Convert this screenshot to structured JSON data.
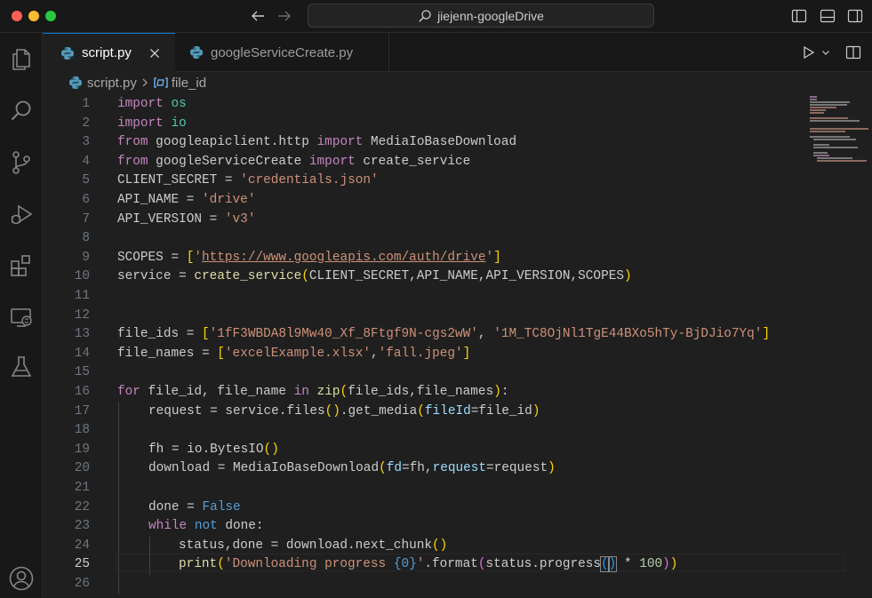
{
  "window": {
    "title": "jiejenn-googleDrive"
  },
  "tabs": [
    {
      "label": "script.py",
      "active": true
    },
    {
      "label": "googleServiceCreate.py",
      "active": false
    }
  ],
  "breadcrumb": {
    "file": "script.py",
    "symbol": "file_id"
  },
  "editor": {
    "current_line": 25,
    "lines": [
      {
        "n": "1"
      },
      {
        "n": "2"
      },
      {
        "n": "3"
      },
      {
        "n": "4"
      },
      {
        "n": "5"
      },
      {
        "n": "6"
      },
      {
        "n": "7"
      },
      {
        "n": "8"
      },
      {
        "n": "9"
      },
      {
        "n": "10"
      },
      {
        "n": "11"
      },
      {
        "n": "12"
      },
      {
        "n": "13"
      },
      {
        "n": "14"
      },
      {
        "n": "15"
      },
      {
        "n": "16"
      },
      {
        "n": "17"
      },
      {
        "n": "18"
      },
      {
        "n": "19"
      },
      {
        "n": "20"
      },
      {
        "n": "21"
      },
      {
        "n": "22"
      },
      {
        "n": "23"
      },
      {
        "n": "24"
      },
      {
        "n": "25"
      },
      {
        "n": "26"
      }
    ],
    "tokens": {
      "l1": [
        "import",
        " os"
      ],
      "l2": [
        "import",
        " io"
      ],
      "l3": [
        "from",
        " googleapiclient.http ",
        "import",
        " MediaIoBaseDownload"
      ],
      "l4": [
        "from",
        " googleServiceCreate ",
        "import",
        " create_service"
      ],
      "l5": [
        "CLIENT_SECRET = ",
        "'credentials.json'"
      ],
      "l6": [
        "API_NAME = ",
        "'drive'"
      ],
      "l7": [
        "API_VERSION = ",
        "'v3'"
      ],
      "l9": [
        "SCOPES = ",
        "[",
        "'",
        "https://www.googleapis.com/auth/drive",
        "'",
        "]"
      ],
      "l10": [
        "service = ",
        "create_service",
        "(",
        "CLIENT_SECRET,API_NAME,API_VERSION,SCOPES",
        ")"
      ],
      "l13": [
        "file_ids = ",
        "[",
        "'1fF3WBDA8l9Mw40_Xf_8Ftgf9N-cgs2wW'",
        ", ",
        "'1M_TC8OjNl1TgE44BXo5hTy-BjDJio7Yq'",
        "]"
      ],
      "l14": [
        "file_names = ",
        "[",
        "'excelExample.xlsx'",
        ",",
        "'fall.jpeg'",
        "]"
      ],
      "l16": [
        "for",
        " file_id, file_name ",
        "in",
        " ",
        "zip",
        "(",
        "file_ids,file_names",
        ")",
        ":"
      ],
      "l17": [
        "request = service.files",
        "(",
        ")",
        ".get_media",
        "(",
        "fileId",
        "=file_id",
        ")"
      ],
      "l19": [
        "fh = io.",
        "BytesIO",
        "(",
        ")"
      ],
      "l20": [
        "download = ",
        "MediaIoBaseDownload",
        "(",
        "fd",
        "=fh,",
        "request",
        "=request",
        ")"
      ],
      "l22": [
        "done = ",
        "False"
      ],
      "l23": [
        "while",
        " ",
        "not",
        " done:"
      ],
      "l24": [
        "status,done = download.next_chunk",
        "(",
        ")"
      ],
      "l25": [
        "print",
        "(",
        "'Downloading progress ",
        "{0}",
        "'",
        ".format",
        "(",
        "status.progress",
        "(",
        ")",
        " * ",
        "100",
        ")",
        ")"
      ]
    }
  },
  "colors": {
    "keyword": "#c586c0",
    "string": "#ce9178",
    "function": "#dcdcaa",
    "variable": "#9cdcfe",
    "class": "#4ec9b0",
    "accent": "#0078d4"
  },
  "icons": {
    "activity_bar": [
      "files-icon",
      "search-icon",
      "source-control-icon",
      "run-debug-icon",
      "extensions-icon",
      "remote-explorer-icon",
      "testing-icon",
      "account-icon"
    ]
  }
}
